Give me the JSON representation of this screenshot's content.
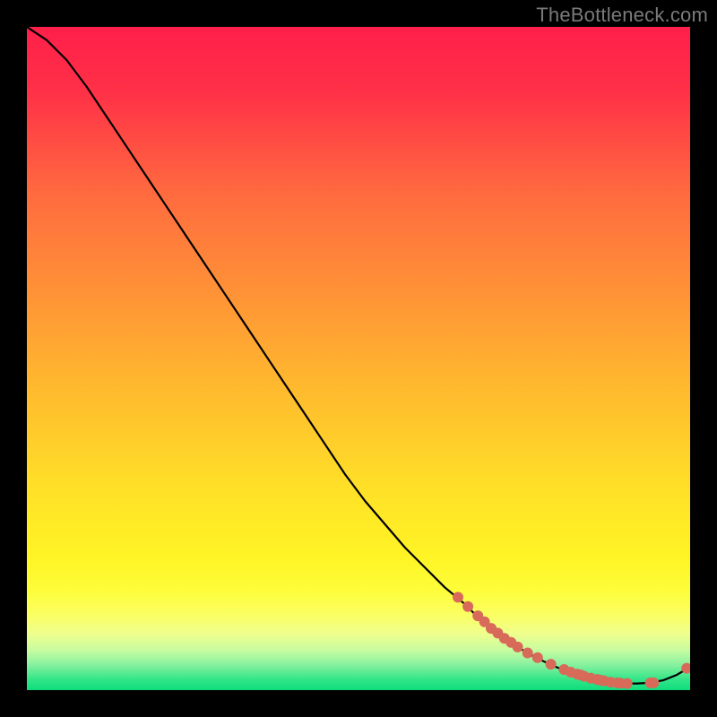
{
  "watermark": "TheBottleneck.com",
  "colors": {
    "marker": "#d86a5a",
    "curve": "#000000"
  },
  "chart_data": {
    "type": "line",
    "x": [
      0.0,
      0.03,
      0.06,
      0.09,
      0.12,
      0.15,
      0.18,
      0.21,
      0.24,
      0.27,
      0.3,
      0.33,
      0.36,
      0.39,
      0.42,
      0.45,
      0.48,
      0.51,
      0.54,
      0.57,
      0.6,
      0.63,
      0.66,
      0.68,
      0.7,
      0.72,
      0.74,
      0.76,
      0.78,
      0.8,
      0.82,
      0.84,
      0.86,
      0.88,
      0.9,
      0.92,
      0.94,
      0.96,
      0.98,
      1.0
    ],
    "values": [
      100,
      98,
      95,
      91,
      86.5,
      82,
      77.5,
      73,
      68.5,
      64,
      59.5,
      55,
      50.5,
      46,
      41.5,
      37,
      32.5,
      28.5,
      25,
      21.5,
      18.5,
      15.5,
      13,
      11,
      9.3,
      7.8,
      6.5,
      5.3,
      4.3,
      3.4,
      2.7,
      2.1,
      1.6,
      1.2,
      1.0,
      1.0,
      1.1,
      1.5,
      2.3,
      3.5
    ],
    "marker_x": [
      0.65,
      0.665,
      0.68,
      0.69,
      0.7,
      0.71,
      0.72,
      0.73,
      0.74,
      0.755,
      0.77,
      0.79,
      0.81,
      0.82,
      0.83,
      0.835,
      0.84,
      0.85,
      0.86,
      0.865,
      0.87,
      0.88,
      0.89,
      0.895,
      0.905,
      0.94,
      0.945,
      0.995
    ],
    "marker_y": [
      14.0,
      12.6,
      11.2,
      10.3,
      9.3,
      8.6,
      7.8,
      7.2,
      6.5,
      5.6,
      4.9,
      3.9,
      3.1,
      2.7,
      2.4,
      2.3,
      2.1,
      1.8,
      1.6,
      1.5,
      1.4,
      1.2,
      1.1,
      1.05,
      1.0,
      1.1,
      1.1,
      3.3
    ],
    "xlim": [
      0,
      1
    ],
    "ylim": [
      0,
      100
    ],
    "title": "",
    "xlabel": "",
    "ylabel": ""
  }
}
